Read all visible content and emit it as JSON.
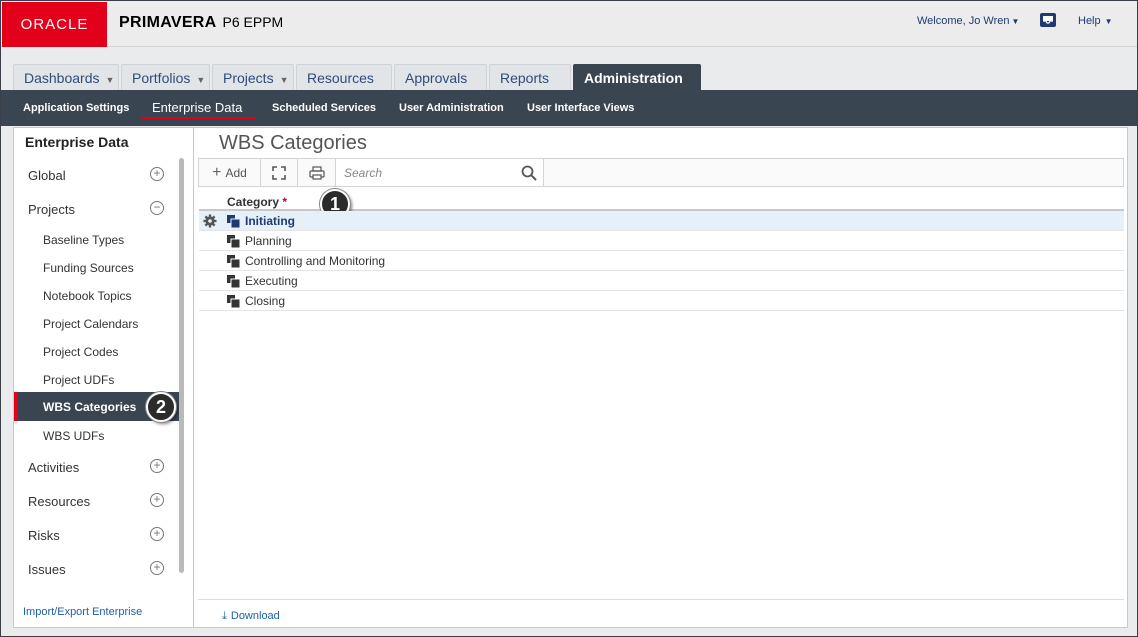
{
  "header": {
    "logo": "ORACLE",
    "product_bold": "PRIMAVERA",
    "product_rest": "P6 EPPM",
    "welcome": "Welcome, Jo Wren",
    "help": "Help"
  },
  "tabs": [
    {
      "label": "Dashboards"
    },
    {
      "label": "Portfolios"
    },
    {
      "label": "Projects"
    },
    {
      "label": "Resources"
    },
    {
      "label": "Approvals"
    },
    {
      "label": "Reports"
    },
    {
      "label": "Administration"
    }
  ],
  "subnav": [
    {
      "label": "Application Settings"
    },
    {
      "label": "Enterprise Data"
    },
    {
      "label": "Scheduled Services"
    },
    {
      "label": "User Administration"
    },
    {
      "label": "User Interface Views"
    }
  ],
  "leftnav": {
    "title": "Enterprise Data",
    "global": "Global",
    "projects": "Projects",
    "sub": [
      "Baseline Types",
      "Funding Sources",
      "Notebook Topics",
      "Project Calendars",
      "Project Codes",
      "Project UDFs",
      "WBS Categories",
      "WBS UDFs"
    ],
    "activities": "Activities",
    "resources": "Resources",
    "risks": "Risks",
    "issues": "Issues",
    "bottom_link": "Import/Export Enterprise"
  },
  "main": {
    "title": "WBS Categories",
    "add_label": "Add",
    "search_placeholder": "Search",
    "column_header": "Category",
    "required_marker": "*",
    "rows": [
      "Initiating",
      "Planning",
      "Controlling and Monitoring",
      "Executing",
      "Closing"
    ],
    "download": "Download"
  },
  "callouts": {
    "one": "1",
    "two": "2"
  },
  "colors": {
    "oracle_red": "#e2001a",
    "nav_dark": "#3a4552",
    "link_blue": "#1f5fa8"
  }
}
